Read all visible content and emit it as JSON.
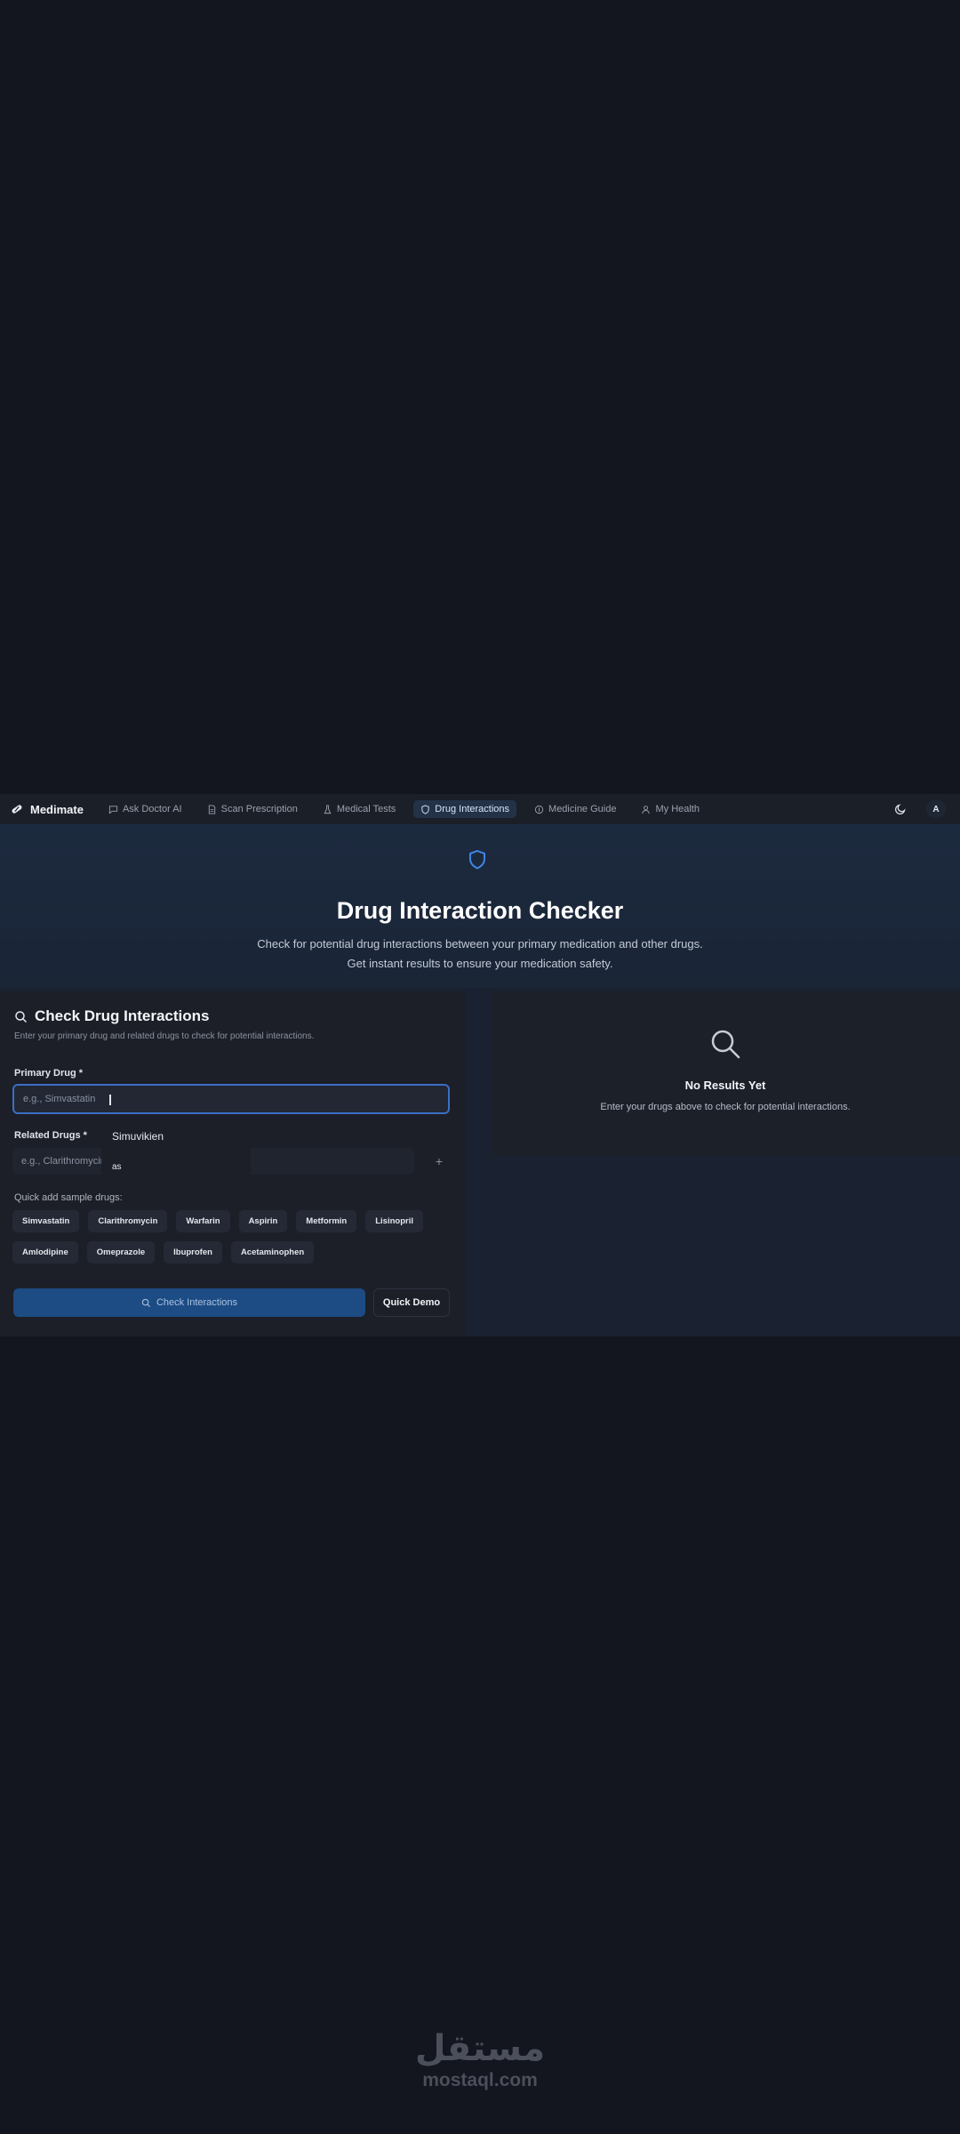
{
  "nav": {
    "brand": "Medimate",
    "items": [
      {
        "label": "Ask Doctor AI",
        "icon": "chat-icon",
        "active": false
      },
      {
        "label": "Scan Prescription",
        "icon": "document-icon",
        "active": false
      },
      {
        "label": "Medical Tests",
        "icon": "flask-icon",
        "active": false
      },
      {
        "label": "Drug Interactions",
        "icon": "shield-icon",
        "active": true
      },
      {
        "label": "Medicine Guide",
        "icon": "pill-icon",
        "active": false
      },
      {
        "label": "My Health",
        "icon": "user-icon",
        "active": false
      }
    ],
    "avatar": "A",
    "theme_icon": "moon-icon"
  },
  "hero": {
    "title": "Drug Interaction Checker",
    "subtitle_line1": "Check for potential drug interactions between your primary medication and other drugs.",
    "subtitle_line2": "Get instant results to ensure your medication safety."
  },
  "form": {
    "title": "Check Drug Interactions",
    "description": "Enter your primary drug and related drugs to check for potential interactions.",
    "primary_label": "Primary Drug *",
    "primary_placeholder": "e.g., Simvastatin",
    "related_label": "Related Drugs *",
    "related_placeholder": "e.g., Clarithromycin",
    "add_symbol": "+",
    "autocomplete": [
      "Simuvikien",
      "as"
    ],
    "quick_add_label": "Quick add sample drugs:",
    "sample_drugs": [
      "Simvastatin",
      "Clarithromycin",
      "Warfarin",
      "Aspirin",
      "Metformin",
      "Lisinopril",
      "Amlodipine",
      "Omeprazole",
      "Ibuprofen",
      "Acetaminophen"
    ],
    "check_button": "Check Interactions",
    "demo_button": "Quick Demo"
  },
  "results": {
    "title": "No Results Yet",
    "description": "Enter your drugs above to check for potential interactions."
  },
  "watermark": {
    "arabic": "مستقل",
    "latin": "mostaql.com"
  },
  "colors": {
    "page_bg": "#13151f",
    "accent": "#3a6fc4",
    "primary_button": "#1d4c84"
  }
}
